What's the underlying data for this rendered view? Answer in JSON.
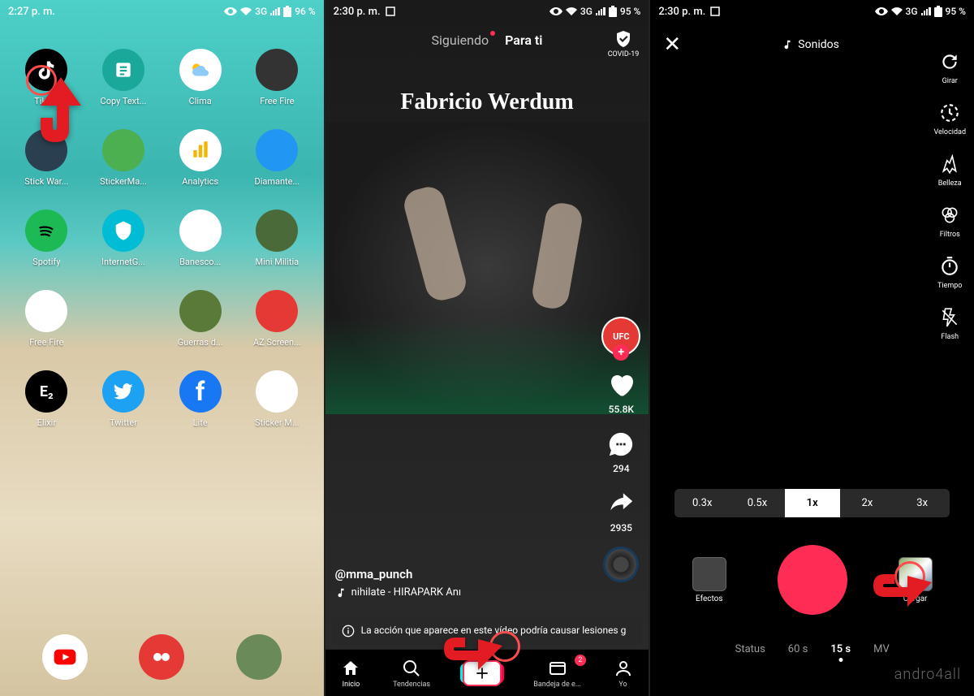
{
  "screen1": {
    "status": {
      "time": "2:27 p. m.",
      "network": "3G",
      "battery": "96 %"
    },
    "apps": [
      {
        "label": "Tiktok",
        "icon": "tiktok"
      },
      {
        "label": "Copy Text...",
        "icon": "copytext"
      },
      {
        "label": "Clima",
        "icon": "clima"
      },
      {
        "label": "Free Fire",
        "icon": "freefire"
      },
      {
        "label": "Stick War...",
        "icon": "stickwar"
      },
      {
        "label": "StickerMa...",
        "icon": "stickermaker"
      },
      {
        "label": "Analytics",
        "icon": "analytics"
      },
      {
        "label": "Diamante...",
        "icon": "diamante"
      },
      {
        "label": "Spotify",
        "icon": "spotify"
      },
      {
        "label": "InternetG...",
        "icon": "internet"
      },
      {
        "label": "Banesco...",
        "icon": "banesco"
      },
      {
        "label": "Mini Militia",
        "icon": "minimilitia"
      },
      {
        "label": "Free Fire",
        "icon": "freefire2"
      },
      {
        "label": "",
        "icon": "empty"
      },
      {
        "label": "Guerras d...",
        "icon": "guerras"
      },
      {
        "label": "AZ Screen...",
        "icon": "azscreen"
      },
      {
        "label": "Elixir",
        "icon": "elixir",
        "text": "E₂"
      },
      {
        "label": "Twitter",
        "icon": "twitter"
      },
      {
        "label": "Lite",
        "icon": "lite",
        "text": "f"
      },
      {
        "label": "Sticker M...",
        "icon": "stickerm"
      }
    ],
    "dock": [
      {
        "icon": "youtube"
      },
      {
        "icon": "recorder"
      },
      {
        "icon": "game"
      }
    ]
  },
  "screen2": {
    "status": {
      "time": "2:30 p. m.",
      "network": "3G",
      "battery": "95 %"
    },
    "tabs": {
      "following": "Siguiendo",
      "foryou": "Para ti"
    },
    "covid": "COVID-19",
    "video": {
      "title": "Fabricio Werdum",
      "user": "@mma_punch",
      "sound": "nihilate - HIRAPARK   Anı",
      "avatar_text": "UFC"
    },
    "actions": {
      "likes": "55.8K",
      "comments": "294",
      "shares": "2935"
    },
    "warning": "La acción que aparece en este vídeo podría causar lesiones g",
    "nav": {
      "home": "Inicio",
      "trends": "Tendencias",
      "inbox": "Bandeja de e...",
      "inbox_badge": "2",
      "profile": "Yo"
    }
  },
  "screen3": {
    "status": {
      "time": "2:30 p. m.",
      "network": "3G",
      "battery": "95 %"
    },
    "sounds": "Sonidos",
    "tools": {
      "flip": "Girar",
      "speed": "Velocidad",
      "beauty": "Belleza",
      "filters": "Filtros",
      "timer": "Tiempo",
      "flash": "Flash"
    },
    "speeds": [
      "0.3x",
      "0.5x",
      "1x",
      "2x",
      "3x"
    ],
    "speed_active": "1x",
    "effects": "Efectos",
    "upload": "Cargar",
    "modes": [
      "Status",
      "60 s",
      "15 s",
      "MV"
    ],
    "mode_active": "15 s"
  },
  "watermark": "andro4all"
}
